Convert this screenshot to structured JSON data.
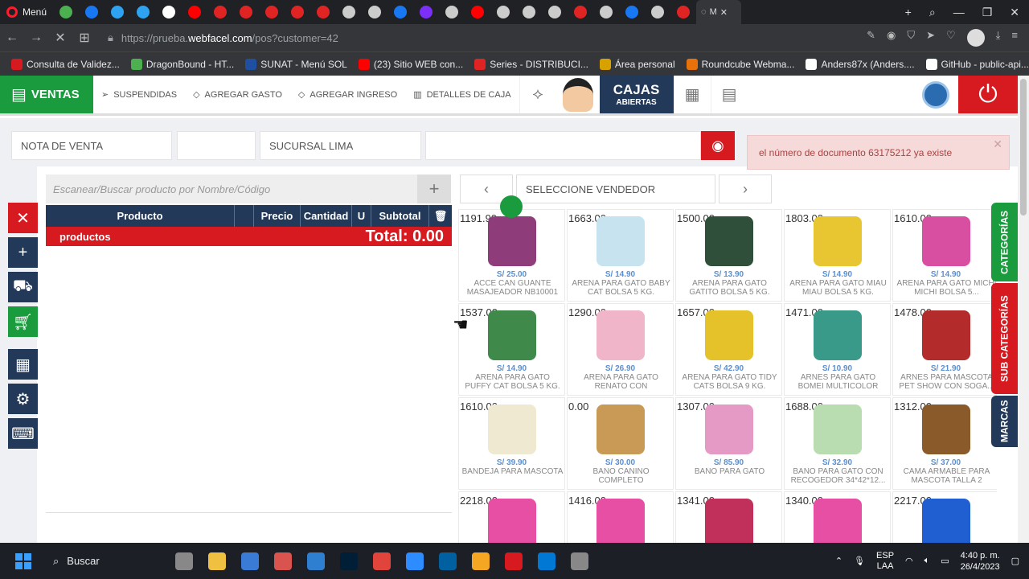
{
  "browser": {
    "first_tab_label": "Menú",
    "active_tab_label": "M",
    "url_prefix": "https://prueba.",
    "url_domain": "webfacel.com",
    "url_path": "/pos?customer=42",
    "tab_icons": [
      "#4caf50",
      "#1877f2",
      "#2ea3f2",
      "#2ea3f2",
      "#fff",
      "#ff0000",
      "#e02424",
      "#e02424",
      "#e02424",
      "#e02424",
      "#e02424",
      "#ccc",
      "#ccc",
      "#1877f2",
      "#7b2ff7",
      "#ccc",
      "#ff0000",
      "#ccc",
      "#ccc",
      "#ccc",
      "#e02424",
      "#ccc",
      "#1877f2",
      "#ccc",
      "#e02424"
    ],
    "bookmarks": [
      {
        "label": "Consulta de Validez...",
        "color": "#d71920"
      },
      {
        "label": "DragonBound - HT...",
        "color": "#4caf50"
      },
      {
        "label": "SUNAT - Menú SOL",
        "color": "#1e4fa0"
      },
      {
        "label": "(23) Sitio WEB con...",
        "color": "#ff0000"
      },
      {
        "label": "Series - DISTRIBUCI...",
        "color": "#e02424"
      },
      {
        "label": "Área personal",
        "color": "#d7a200"
      },
      {
        "label": "Roundcube Webma...",
        "color": "#e8710a"
      },
      {
        "label": "Anders87x (Anders....",
        "color": "#ffffff"
      },
      {
        "label": "GitHub - public-api...",
        "color": "#ffffff"
      }
    ]
  },
  "header": {
    "ventas": "VENTAS",
    "links": [
      "SUSPENDIDAS",
      "AGREGAR GASTO",
      "AGREGAR INGRESO",
      "DETALLES DE CAJA"
    ],
    "cajas_line1": "CAJAS",
    "cajas_line2": "ABIERTAS"
  },
  "form": {
    "doc_type": "NOTA DE VENTA",
    "sucursal": "SUCURSAL LIMA"
  },
  "alert": {
    "message": "el número de documento 63175212 ya existe"
  },
  "search": {
    "placeholder": "Escanear/Buscar producto por Nombre/Código"
  },
  "cart": {
    "columns": [
      "Producto",
      "Precio",
      "Cantidad",
      "U",
      "Subtotal"
    ],
    "total_label": "productos",
    "total_value": "Total: 0.00"
  },
  "vendor": {
    "placeholder": "SELECCIONE VENDEDOR"
  },
  "categories": [
    {
      "label": "CATEGORÍAS",
      "color": "#1a9c3e"
    },
    {
      "label": "SUB CATEGORÍAS",
      "color": "#d71920"
    },
    {
      "label": "MARCAS",
      "color": "#22395a"
    }
  ],
  "products": [
    {
      "stock": "1191.90",
      "price": "S/ 25.00",
      "name": "ACCE CAN GUANTE MASAJEADOR NB10001",
      "color": "#8e3c7a"
    },
    {
      "stock": "1663.00",
      "price": "S/ 14.90",
      "name": "ARENA PARA GATO BABY CAT BOLSA 5 KG.",
      "color": "#c7e3f0"
    },
    {
      "stock": "1500.00",
      "price": "S/ 13.90",
      "name": "ARENA PARA GATO GATITO BOLSA 5 KG.",
      "color": "#2f4f3a"
    },
    {
      "stock": "1803.00",
      "price": "S/ 14.90",
      "name": "ARENA PARA GATO MIAU MIAU BOLSA 5 KG.",
      "color": "#e8c632"
    },
    {
      "stock": "1610.00",
      "price": "S/ 14.90",
      "name": "ARENA PARA GATO MICHI MICHI BOLSA 5...",
      "color": "#d84ea0"
    },
    {
      "stock": "1537.00",
      "price": "S/ 14.90",
      "name": "ARENA PARA GATO PUFFY CAT BOLSA 5 KG.",
      "color": "#3f8a4a"
    },
    {
      "stock": "1290.00",
      "price": "S/ 26.90",
      "name": "ARENA PARA GATO RENATO CON NEUTRALIZADOR",
      "color": "#f0b5c8"
    },
    {
      "stock": "1657.00",
      "price": "S/ 42.90",
      "name": "ARENA PARA GATO TIDY CATS BOLSA 9 KG.",
      "color": "#e5c22a"
    },
    {
      "stock": "1471.00",
      "price": "S/ 10.90",
      "name": "ARNES PARA GATO BOMEI MULTICOLOR",
      "color": "#3a9a8a"
    },
    {
      "stock": "1478.00",
      "price": "S/ 21.90",
      "name": "ARNES PARA MASCOTA PET SHOW CON SOGA...",
      "color": "#b32b2b"
    },
    {
      "stock": "1610.00",
      "price": "S/ 39.90",
      "name": "BANDEJA PARA MASCOTA",
      "color": "#efe9d2"
    },
    {
      "stock": "0.00",
      "price": "S/ 30.00",
      "name": "BAÑO CANINO COMPLETO",
      "color": "#c89a55"
    },
    {
      "stock": "1307.00",
      "price": "S/ 85.90",
      "name": "BAÑO PARA GATO",
      "color": "#e59ac6"
    },
    {
      "stock": "1688.00",
      "price": "S/ 32.90",
      "name": "BAÑO PARA GATO CON RECOGEDOR 34*42*12...",
      "color": "#b9dcb0"
    },
    {
      "stock": "1312.00",
      "price": "S/ 37.00",
      "name": "CAMA ARMABLE PARA MASCOTA TALLA 2",
      "color": "#8a5a2a"
    },
    {
      "stock": "2218.00",
      "price": "",
      "name": "",
      "color": "#e64fa3"
    },
    {
      "stock": "1416.00",
      "price": "",
      "name": "",
      "color": "#e64fa3"
    },
    {
      "stock": "1341.00",
      "price": "",
      "name": "",
      "color": "#c0305a"
    },
    {
      "stock": "1340.00",
      "price": "",
      "name": "",
      "color": "#e64fa3"
    },
    {
      "stock": "2217.00",
      "price": "",
      "name": "",
      "color": "#1f5fd1"
    }
  ],
  "taskbar": {
    "search_label": "Buscar",
    "lang_line1": "ESP",
    "lang_line2": "LAA",
    "time": "4:40 p. m.",
    "date": "26/4/2023",
    "apps": [
      "#888",
      "#f0c040",
      "#3a7bd5",
      "#d9534f",
      "#2f7fd1",
      "#001e36",
      "#e0443a",
      "#2d8cff",
      "#0060a0",
      "#f5a623",
      "#d71920",
      "#0078d4",
      "#888"
    ]
  }
}
